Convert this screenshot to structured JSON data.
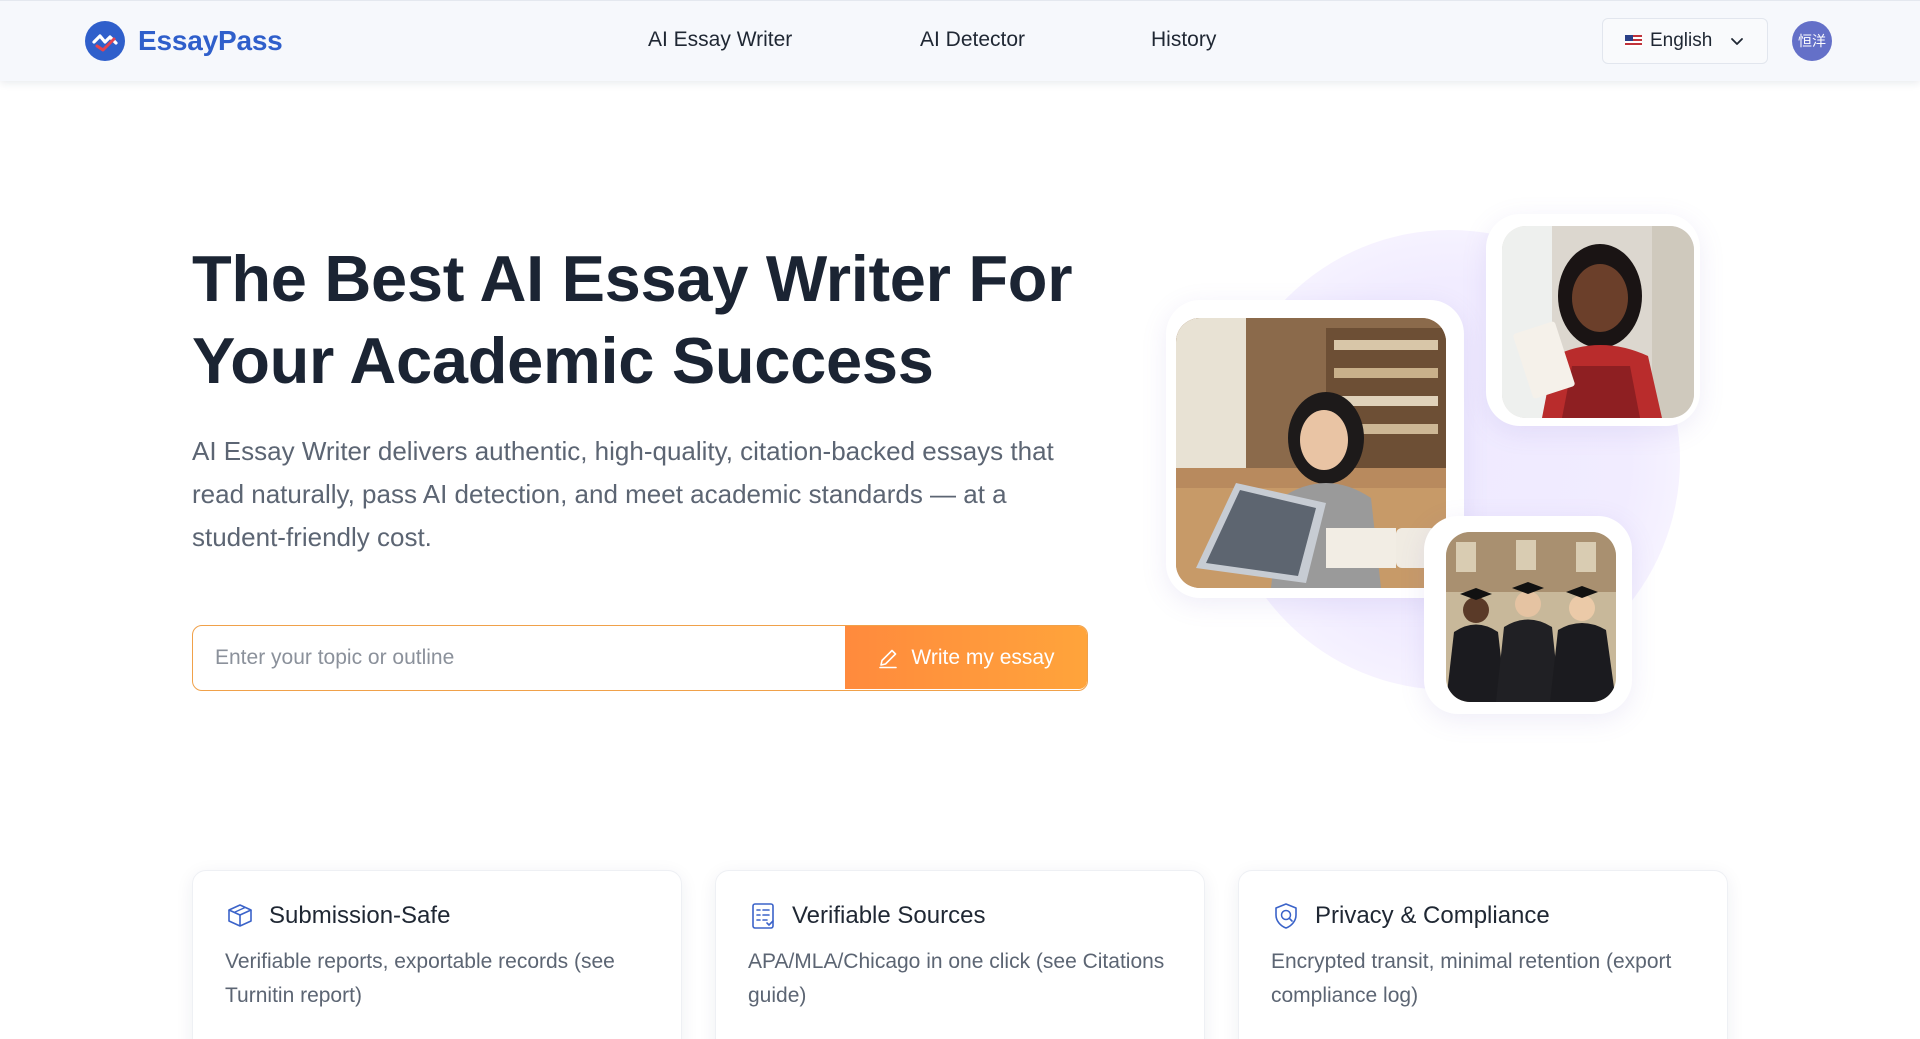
{
  "nav": {
    "brand": "EssayPass",
    "links": [
      "AI Essay Writer",
      "AI Detector",
      "History"
    ],
    "language": "English",
    "avatar_text": "恒洋"
  },
  "hero": {
    "title_line1": "The Best AI Essay Writer For",
    "title_line2": "Your Academic Success",
    "subtitle": "AI Essay Writer delivers authentic, high-quality, citation-backed essays that read naturally, pass AI detection, and meet academic standards — at a student-friendly cost.",
    "input_placeholder": "Enter your topic or outline",
    "cta_label": "Write my essay"
  },
  "features": [
    {
      "icon": "package-icon",
      "title": "Submission-Safe",
      "description": "Verifiable reports, exportable records (see Turnitin report)"
    },
    {
      "icon": "document-list-icon",
      "title": "Verifiable Sources",
      "description": "APA/MLA/Chicago in one click (see Citations guide)"
    },
    {
      "icon": "shield-icon",
      "title": "Privacy & Compliance",
      "description": "Encrypted transit, minimal retention (export compliance log)"
    }
  ],
  "colors": {
    "brand": "#2f5fcb",
    "accent": "#ff9a3c",
    "text": "#1b2433",
    "muted": "#5c6573"
  }
}
